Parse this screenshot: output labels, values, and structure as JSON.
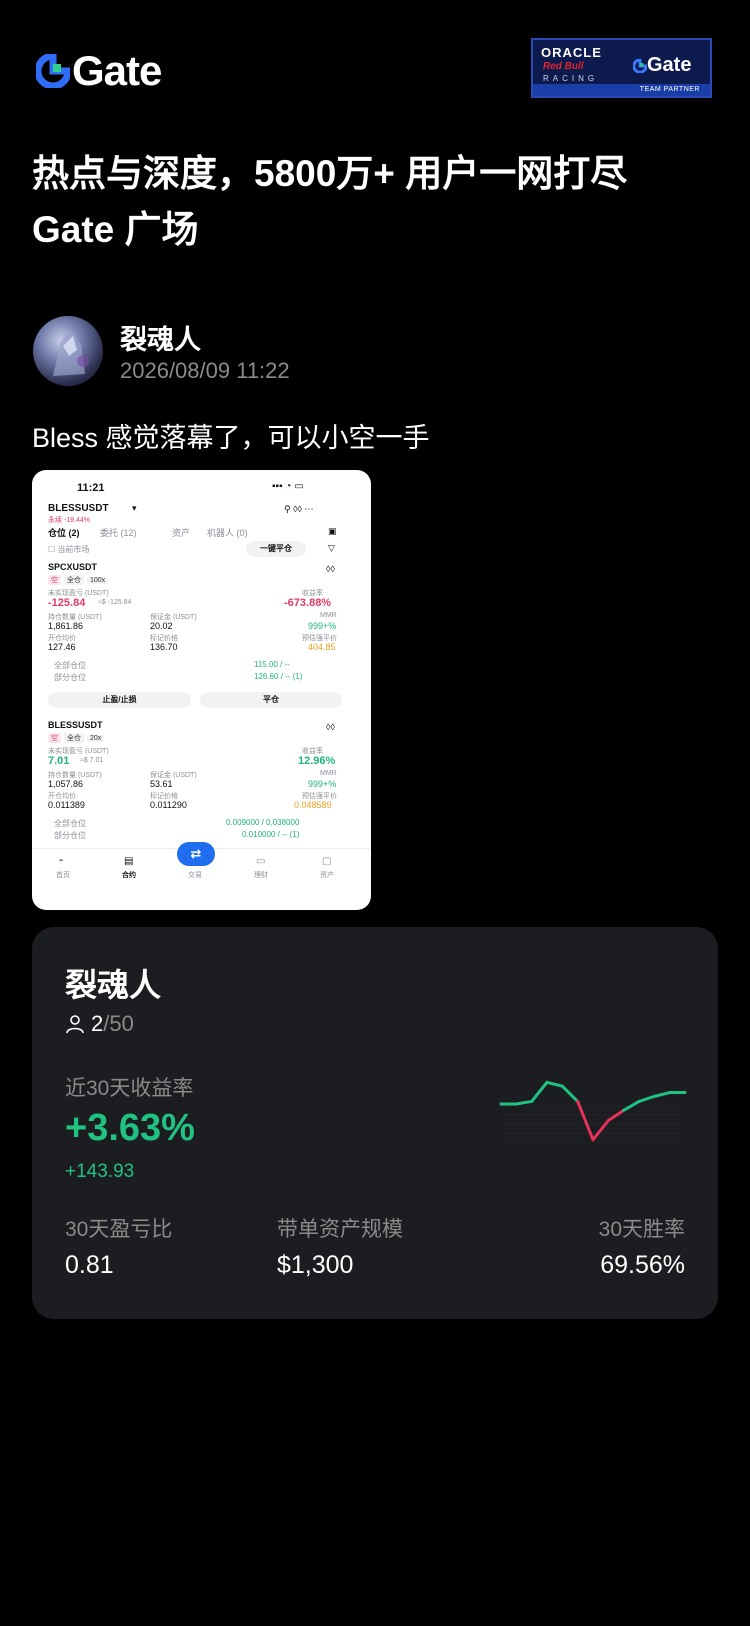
{
  "header": {
    "brand": "Gate",
    "partner_badge": {
      "oracle": "ORACLE",
      "redbull": "Red Bull",
      "racing": "RACING",
      "gate": "Gate",
      "team_partner": "TEAM PARTNER"
    }
  },
  "headline": {
    "line1": "热点与深度，5800万+ 用户一网打尽",
    "line2": "Gate 广场"
  },
  "post": {
    "author": "裂魂人",
    "time": "2026/08/09 11:22",
    "text": "Bless 感觉落幕了，可以小空一手"
  },
  "embedded_screenshot": {
    "status_time": "11:21",
    "pair": "BLESSUSDT",
    "pair_sub": "永续 -19.44%",
    "tabs": [
      "仓位 (2)",
      "委托 (12)",
      "资产",
      "机器人 (0)"
    ],
    "current_market": "当前市场",
    "close_all": "一键平仓",
    "positions": [
      {
        "symbol": "SPCXUSDT",
        "side": "空",
        "mode": "全仓",
        "leverage": "100x",
        "pnl_label": "未实现盈亏 (USDT)",
        "pnl": "-125.84",
        "pnl_approx": "≈$ -125.84",
        "roe_label": "收益率",
        "roe": "-673.88%",
        "qty_label": "持仓数量 (USDT)",
        "qty": "1,861.86",
        "margin_label": "保证金 (USDT)",
        "margin": "20.02",
        "mmr_label": "MMR",
        "mmr": "999+%",
        "entry_label": "开仓均价",
        "entry": "127.46",
        "mark_label": "标记价格",
        "mark": "136.70",
        "liq_label": "预估强平价",
        "liq": "404.85",
        "full_tp_label": "全部仓位",
        "full_tp": "115.00 / --",
        "part_tp_label": "部分仓位",
        "part_tp": "126.60 / -- (1)"
      },
      {
        "symbol": "BLESSUSDT",
        "side": "空",
        "mode": "全仓",
        "leverage": "20x",
        "pnl_label": "未实现盈亏 (USDT)",
        "pnl": "7.01",
        "pnl_approx": "≈$ 7.01",
        "roe_label": "收益率",
        "roe": "12.96%",
        "qty_label": "持仓数量 (USDT)",
        "qty": "1,057.86",
        "margin_label": "保证金 (USDT)",
        "margin": "53.61",
        "mmr_label": "MMR",
        "mmr": "999+%",
        "entry_label": "开仓均价",
        "entry": "0.011389",
        "mark_label": "标记价格",
        "mark": "0.011290",
        "liq_label": "预估强平价",
        "liq": "0.048589",
        "full_tp_label": "全部仓位",
        "full_tp": "0.009000 / 0.038000",
        "part_tp_label": "部分仓位",
        "part_tp": "0.010000 / -- (1)"
      }
    ],
    "btn_tpsl": "止盈/止损",
    "btn_close": "平仓",
    "nav": [
      "首页",
      "合约",
      "交易",
      "理财",
      "资产"
    ]
  },
  "card": {
    "name": "裂魂人",
    "followers_current": "2",
    "followers_total": "/50",
    "return_label": "近30天收益率",
    "return_pct": "+3.63%",
    "return_abs": "+143.93",
    "stats": [
      {
        "label": "30天盈亏比",
        "value": "0.81"
      },
      {
        "label": "带单资产规模",
        "value": "$1,300"
      },
      {
        "label": "30天胜率",
        "value": "69.56%"
      }
    ],
    "colors": {
      "up": "#20c281",
      "down": "#e5315e"
    },
    "sparkline": [
      0.38,
      0.38,
      0.4,
      0.55,
      0.52,
      0.4,
      0.1,
      0.25,
      0.33,
      0.4,
      0.44,
      0.47,
      0.47
    ]
  }
}
